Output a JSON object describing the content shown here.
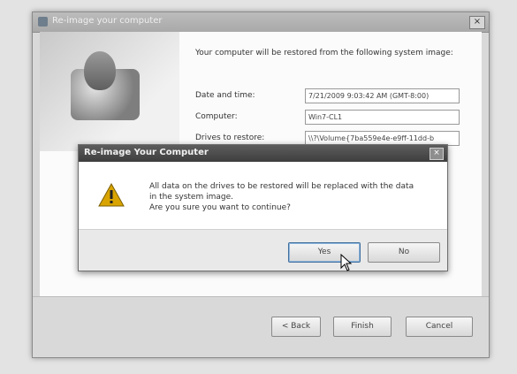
{
  "wizard": {
    "title": "Re-image your computer",
    "close_glyph": "×",
    "intro": "Your computer will be restored from the following system image:",
    "rows": [
      {
        "label": "Date and time:",
        "value": "7/21/2009 9:03:42 AM (GMT-8:00)"
      },
      {
        "label": "Computer:",
        "value": "Win7-CL1"
      },
      {
        "label": "Drives to restore:",
        "value": "\\\\?\\Volume{7ba559e4e-e9ff-11dd-b"
      }
    ],
    "buttons": {
      "back": "< Back",
      "finish": "Finish",
      "cancel": "Cancel"
    }
  },
  "dialog": {
    "title": "Re-image Your Computer",
    "close_glyph": "×",
    "message_lines": [
      "All data on the drives to be restored will be replaced with the data",
      "in the system image.",
      "Are you sure you want to continue?"
    ],
    "buttons": {
      "yes": "Yes",
      "no": "No"
    }
  },
  "icons": {
    "warning": "warning-icon",
    "cursor": "mouse-pointer-icon",
    "wizard_art": "restore-art-icon"
  },
  "colors": {
    "warning": "#d9a400",
    "dialog_title_bar": "#4a4a4a",
    "window_bg": "#d9d9d9"
  }
}
